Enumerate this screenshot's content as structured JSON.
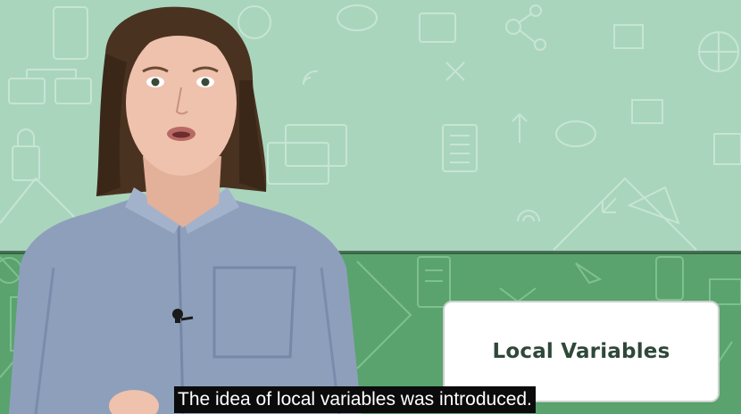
{
  "video": {
    "title_card": "Local Variables",
    "caption": "The idea of local variables was introduced."
  },
  "colors": {
    "background_top": "#a9d5bd",
    "background_bottom": "#5aa36e",
    "card": "#ffffff",
    "card_text": "#2f4838",
    "caption_bg": "#0b0b0b"
  }
}
